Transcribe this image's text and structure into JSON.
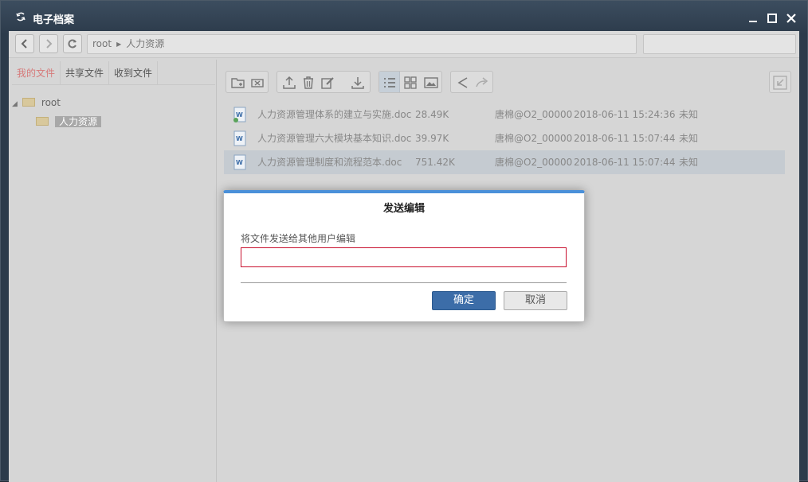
{
  "window": {
    "title": "电子档案",
    "icons": {
      "app": "refresh-icon",
      "minimize": "minimize-icon",
      "maximize": "maximize-icon",
      "close": "close-icon"
    }
  },
  "nav": {
    "back_icon": "chevron-left-icon",
    "forward_icon": "chevron-right-icon",
    "refresh_icon": "refresh-icon",
    "path": [
      "root",
      "人力资源"
    ],
    "search_value": ""
  },
  "sidebar": {
    "tabs": [
      {
        "label": "我的文件",
        "active": true
      },
      {
        "label": "共享文件",
        "active": false
      },
      {
        "label": "收到文件",
        "active": false
      }
    ],
    "tree": [
      {
        "label": "root",
        "expanded": true,
        "selected": false
      },
      {
        "label": "人力资源",
        "selected": true
      }
    ]
  },
  "toolbar": {
    "groups": [
      [
        "new-folder-icon",
        "move-icon"
      ],
      [
        "upload-icon",
        "delete-icon",
        "edit-icon",
        "download-icon"
      ],
      [
        "list-view-icon",
        "grid-view-icon",
        "image-view-icon"
      ],
      [
        "share-icon",
        "forward-icon"
      ]
    ],
    "right_icon": "collapse-icon"
  },
  "files": [
    {
      "name": "人力资源管理体系的建立与实施.doc",
      "size": "28.49K",
      "owner": "唐棉@O2_00000",
      "date": "2018-06-11 15:24:36",
      "status": "未知",
      "selected": false
    },
    {
      "name": "人力资源管理六大模块基本知识.doc",
      "size": "39.97K",
      "owner": "唐棉@O2_00000",
      "date": "2018-06-11 15:07:44",
      "status": "未知",
      "selected": false
    },
    {
      "name": "人力资源管理制度和流程范本.doc",
      "size": "751.42K",
      "owner": "唐棉@O2_00000",
      "date": "2018-06-11 15:07:44",
      "status": "未知",
      "selected": true
    }
  ],
  "dialog": {
    "title": "发送编辑",
    "label": "将文件发送给其他用户编辑",
    "input_value": "",
    "ok_label": "确定",
    "cancel_label": "取消",
    "accent_color": "#4a90d9",
    "error_border_color": "#c8102e"
  }
}
